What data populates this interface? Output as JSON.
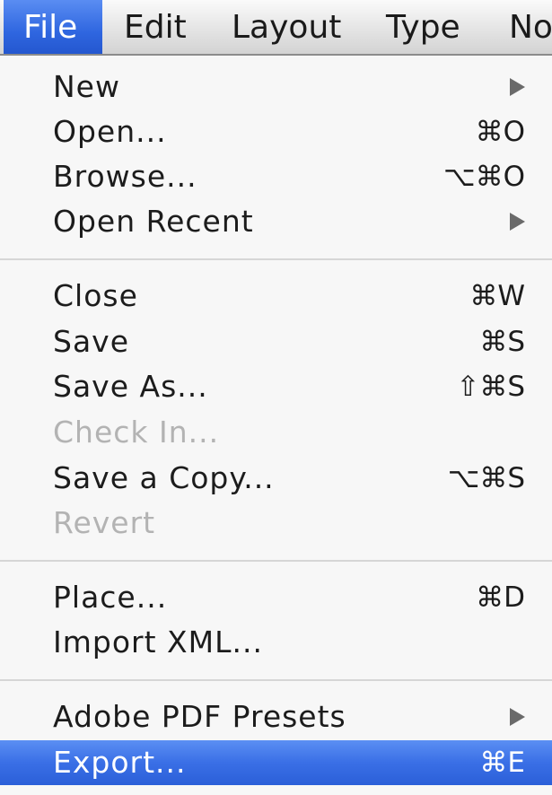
{
  "menubar": {
    "items": [
      {
        "label": "File"
      },
      {
        "label": "Edit"
      },
      {
        "label": "Layout"
      },
      {
        "label": "Type"
      },
      {
        "label": "No"
      }
    ]
  },
  "file_menu": {
    "items": [
      {
        "label": "New",
        "shortcut": "",
        "submenu": true,
        "enabled": true
      },
      {
        "label": "Open...",
        "shortcut": "⌘O",
        "enabled": true
      },
      {
        "label": "Browse...",
        "shortcut": "⌥⌘O",
        "enabled": true
      },
      {
        "label": "Open Recent",
        "shortcut": "",
        "submenu": true,
        "enabled": true
      },
      {
        "label": "Close",
        "shortcut": "⌘W",
        "enabled": true
      },
      {
        "label": "Save",
        "shortcut": "⌘S",
        "enabled": true
      },
      {
        "label": "Save As...",
        "shortcut": "⇧⌘S",
        "enabled": true
      },
      {
        "label": "Check In...",
        "shortcut": "",
        "enabled": false
      },
      {
        "label": "Save a Copy...",
        "shortcut": "⌥⌘S",
        "enabled": true
      },
      {
        "label": "Revert",
        "shortcut": "",
        "enabled": false
      },
      {
        "label": "Place...",
        "shortcut": "⌘D",
        "enabled": true
      },
      {
        "label": "Import XML...",
        "shortcut": "",
        "enabled": true
      },
      {
        "label": "Adobe PDF Presets",
        "shortcut": "",
        "submenu": true,
        "enabled": true
      },
      {
        "label": "Export...",
        "shortcut": "⌘E",
        "enabled": true,
        "highlighted": true
      }
    ]
  },
  "colors": {
    "highlight": "#3a6fe6",
    "disabled_text": "#b3b3b3",
    "menu_background": "#f7f7f7"
  }
}
